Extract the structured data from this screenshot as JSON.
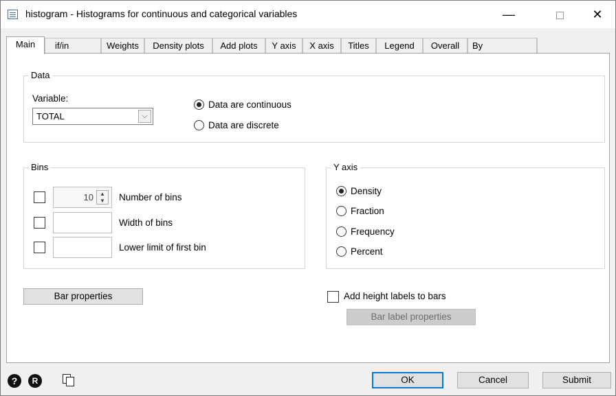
{
  "window": {
    "title": "histogram - Histograms for continuous and categorical variables"
  },
  "titlebar_controls": {
    "minimize": "—",
    "close": "✕"
  },
  "tabs": [
    {
      "label": "Main",
      "active": true
    },
    {
      "label": "if/in"
    },
    {
      "label": "Weights"
    },
    {
      "label": "Density plots"
    },
    {
      "label": "Add plots"
    },
    {
      "label": "Y axis"
    },
    {
      "label": "X axis"
    },
    {
      "label": "Titles"
    },
    {
      "label": "Legend"
    },
    {
      "label": "Overall"
    },
    {
      "label": "By"
    }
  ],
  "data_group": {
    "legend": "Data",
    "variable_label": "Variable:",
    "variable_value": "TOTAL",
    "radio_continuous": "Data are continuous",
    "radio_discrete": "Data are discrete",
    "selected": "continuous"
  },
  "bins_group": {
    "legend": "Bins",
    "number_of_bins_value": "10",
    "number_of_bins_label": "Number of bins",
    "width_label": "Width of bins",
    "lower_limit_label": "Lower limit of first bin"
  },
  "yaxis_group": {
    "legend": "Y axis",
    "options": [
      "Density",
      "Fraction",
      "Frequency",
      "Percent"
    ],
    "selected": "Density"
  },
  "bar_properties_label": "Bar properties",
  "height_labels_label": "Add height labels to bars",
  "bar_label_properties_label": "Bar label properties",
  "footer": {
    "ok": "OK",
    "cancel": "Cancel",
    "submit": "Submit",
    "help_glyph": "?",
    "r_glyph": "R"
  }
}
